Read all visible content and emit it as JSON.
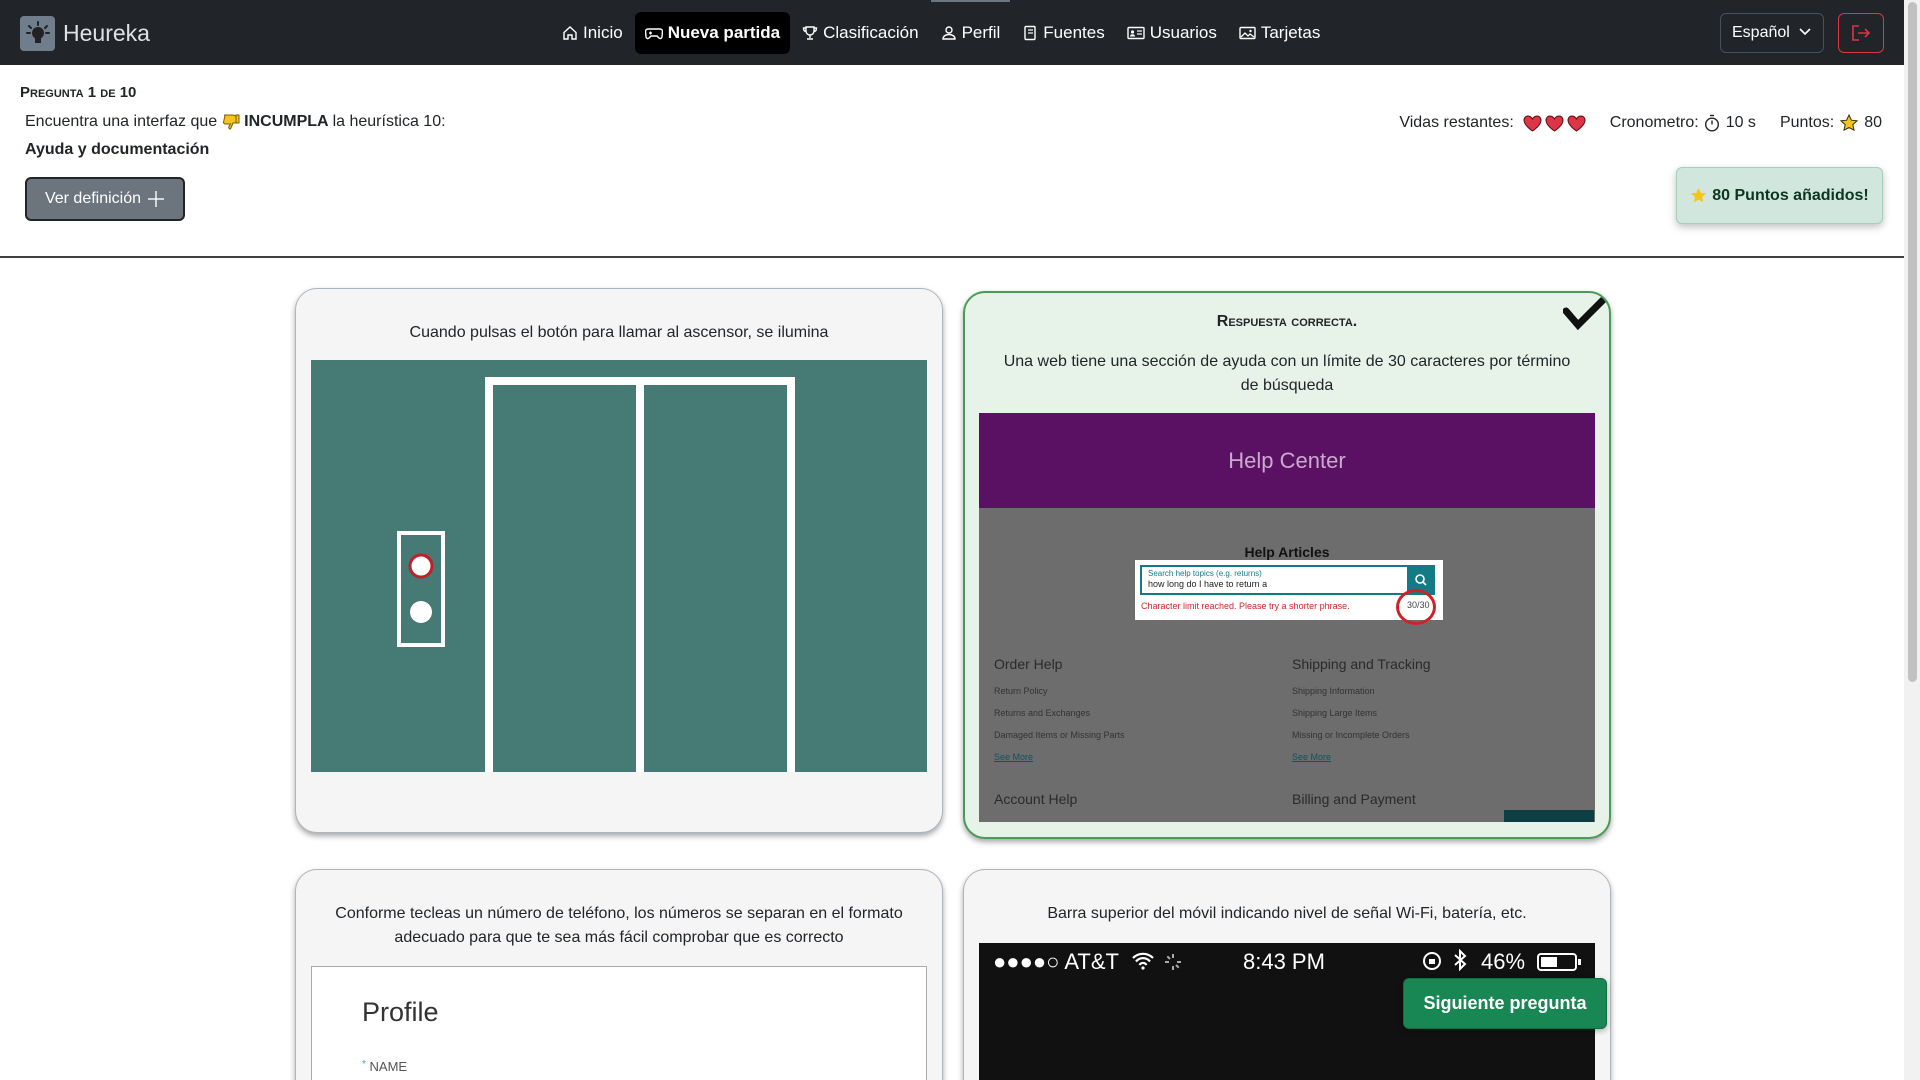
{
  "brand": {
    "name": "Heureka"
  },
  "nav": {
    "items": [
      {
        "label": "Inicio",
        "icon": "house-icon"
      },
      {
        "label": "Nueva partida",
        "icon": "controller-icon",
        "active": true
      },
      {
        "label": "Clasificación",
        "icon": "trophy-icon"
      },
      {
        "label": "Perfil",
        "icon": "person-icon"
      },
      {
        "label": "Fuentes",
        "icon": "book-icon"
      },
      {
        "label": "Usuarios",
        "icon": "person-card-icon"
      },
      {
        "label": "Tarjetas",
        "icon": "image-icon"
      }
    ],
    "language": "Español"
  },
  "question": {
    "label": "Pregunta 1 de 10",
    "prefix": "Encuentra una interfaz que",
    "verb": "INCUMPLA",
    "suffix": "la heurística 10:",
    "heuristic": "Ayuda y documentación",
    "definition_button": "Ver definición"
  },
  "stats": {
    "lives_label": "Vidas restantes:",
    "lives": 3,
    "timer_label": "Cronometro:",
    "timer_value": "10 s",
    "points_label": "Puntos:",
    "points_value": "80"
  },
  "toast": {
    "text": "80 Puntos añadidos!"
  },
  "cards": [
    {
      "text": "Cuando pulsas el botón para llamar al ascensor, se ilumina"
    },
    {
      "title": "Respuesta correcta.",
      "text": "Una web tiene una sección de ayuda con un límite de 30 caracteres por término de búsqueda",
      "image": {
        "header": "Help Center",
        "articles_title": "Help Articles",
        "search_placeholder": "Search help topics (e.g. returns)",
        "search_value": "how long do I have to return a",
        "error": "Character limit reached. Please try a shorter phrase.",
        "counter": "30/30",
        "col1_title": "Order Help",
        "col1_items": [
          "Return Policy",
          "Returns and Exchanges",
          "Damaged Items or Missing Parts"
        ],
        "col1_more": "See More",
        "col2_title": "Shipping and Tracking",
        "col2_items": [
          "Shipping Information",
          "Shipping Large Items",
          "Missing or Incomplete Orders"
        ],
        "col2_more": "See More",
        "col3_title": "Account Help",
        "col4_title": "Billing and Payment"
      }
    },
    {
      "text": "Conforme tecleas un número de teléfono, los números se separan en el formato adecuado para que te sea más fácil comprobar que es correcto",
      "image": {
        "title": "Profile",
        "field_label": "NAME"
      }
    },
    {
      "text": "Barra superior del móvil indicando nivel de señal Wi-Fi, batería, etc.",
      "image": {
        "carrier": "●●●●○ AT&T",
        "time": "8:43 PM",
        "battery": "46%"
      }
    }
  ],
  "next_button": "Siguiente pregunta",
  "colors": {
    "navbar": "#212529",
    "success": "#198754",
    "danger": "#dc3545",
    "elevator_bg": "#467a74",
    "help_header": "#5b1163"
  }
}
